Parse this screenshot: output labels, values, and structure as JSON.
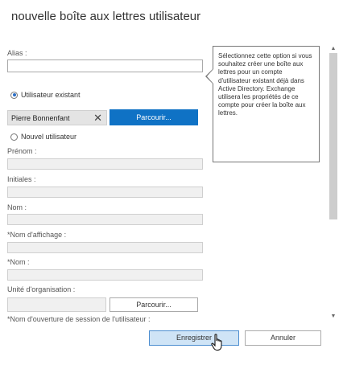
{
  "dialog": {
    "title": "nouvelle boîte aux lettres utilisateur"
  },
  "form": {
    "alias_label": "Alias :",
    "existing_user_label": "Utilisateur existant",
    "selected_user": "Pierre Bonnenfant",
    "remove_glyph": "✕",
    "browse_label": "Parcourir...",
    "new_user_label": "Nouvel utilisateur",
    "firstname_label": "Prénom :",
    "initials_label": "Initiales :",
    "lastname_label": "Nom :",
    "display_name_label": "*Nom d'affichage :",
    "name_label": "*Nom :",
    "ou_label": "Unité d'organisation :",
    "ou_browse_label": "Parcourir...",
    "logon_label": "*Nom d'ouverture de session de l'utilisateur :"
  },
  "tooltip": {
    "text": "Sélectionnez cette option si vous souhaitez créer une boîte aux lettres pour un compte d'utilisateur existant déjà dans Active Directory. Exchange utilisera les propriétés de ce compte pour créer la boîte aux lettres."
  },
  "footer": {
    "save_label": "Enregistrer",
    "cancel_label": "Annuler"
  },
  "scrollbar": {
    "up_glyph": "▲",
    "down_glyph": "▼"
  },
  "state": {
    "selected_option": "Utilisateur existant"
  },
  "colors": {
    "accent": "#0f72c5",
    "save_button_bg": "#cfe4f6"
  }
}
